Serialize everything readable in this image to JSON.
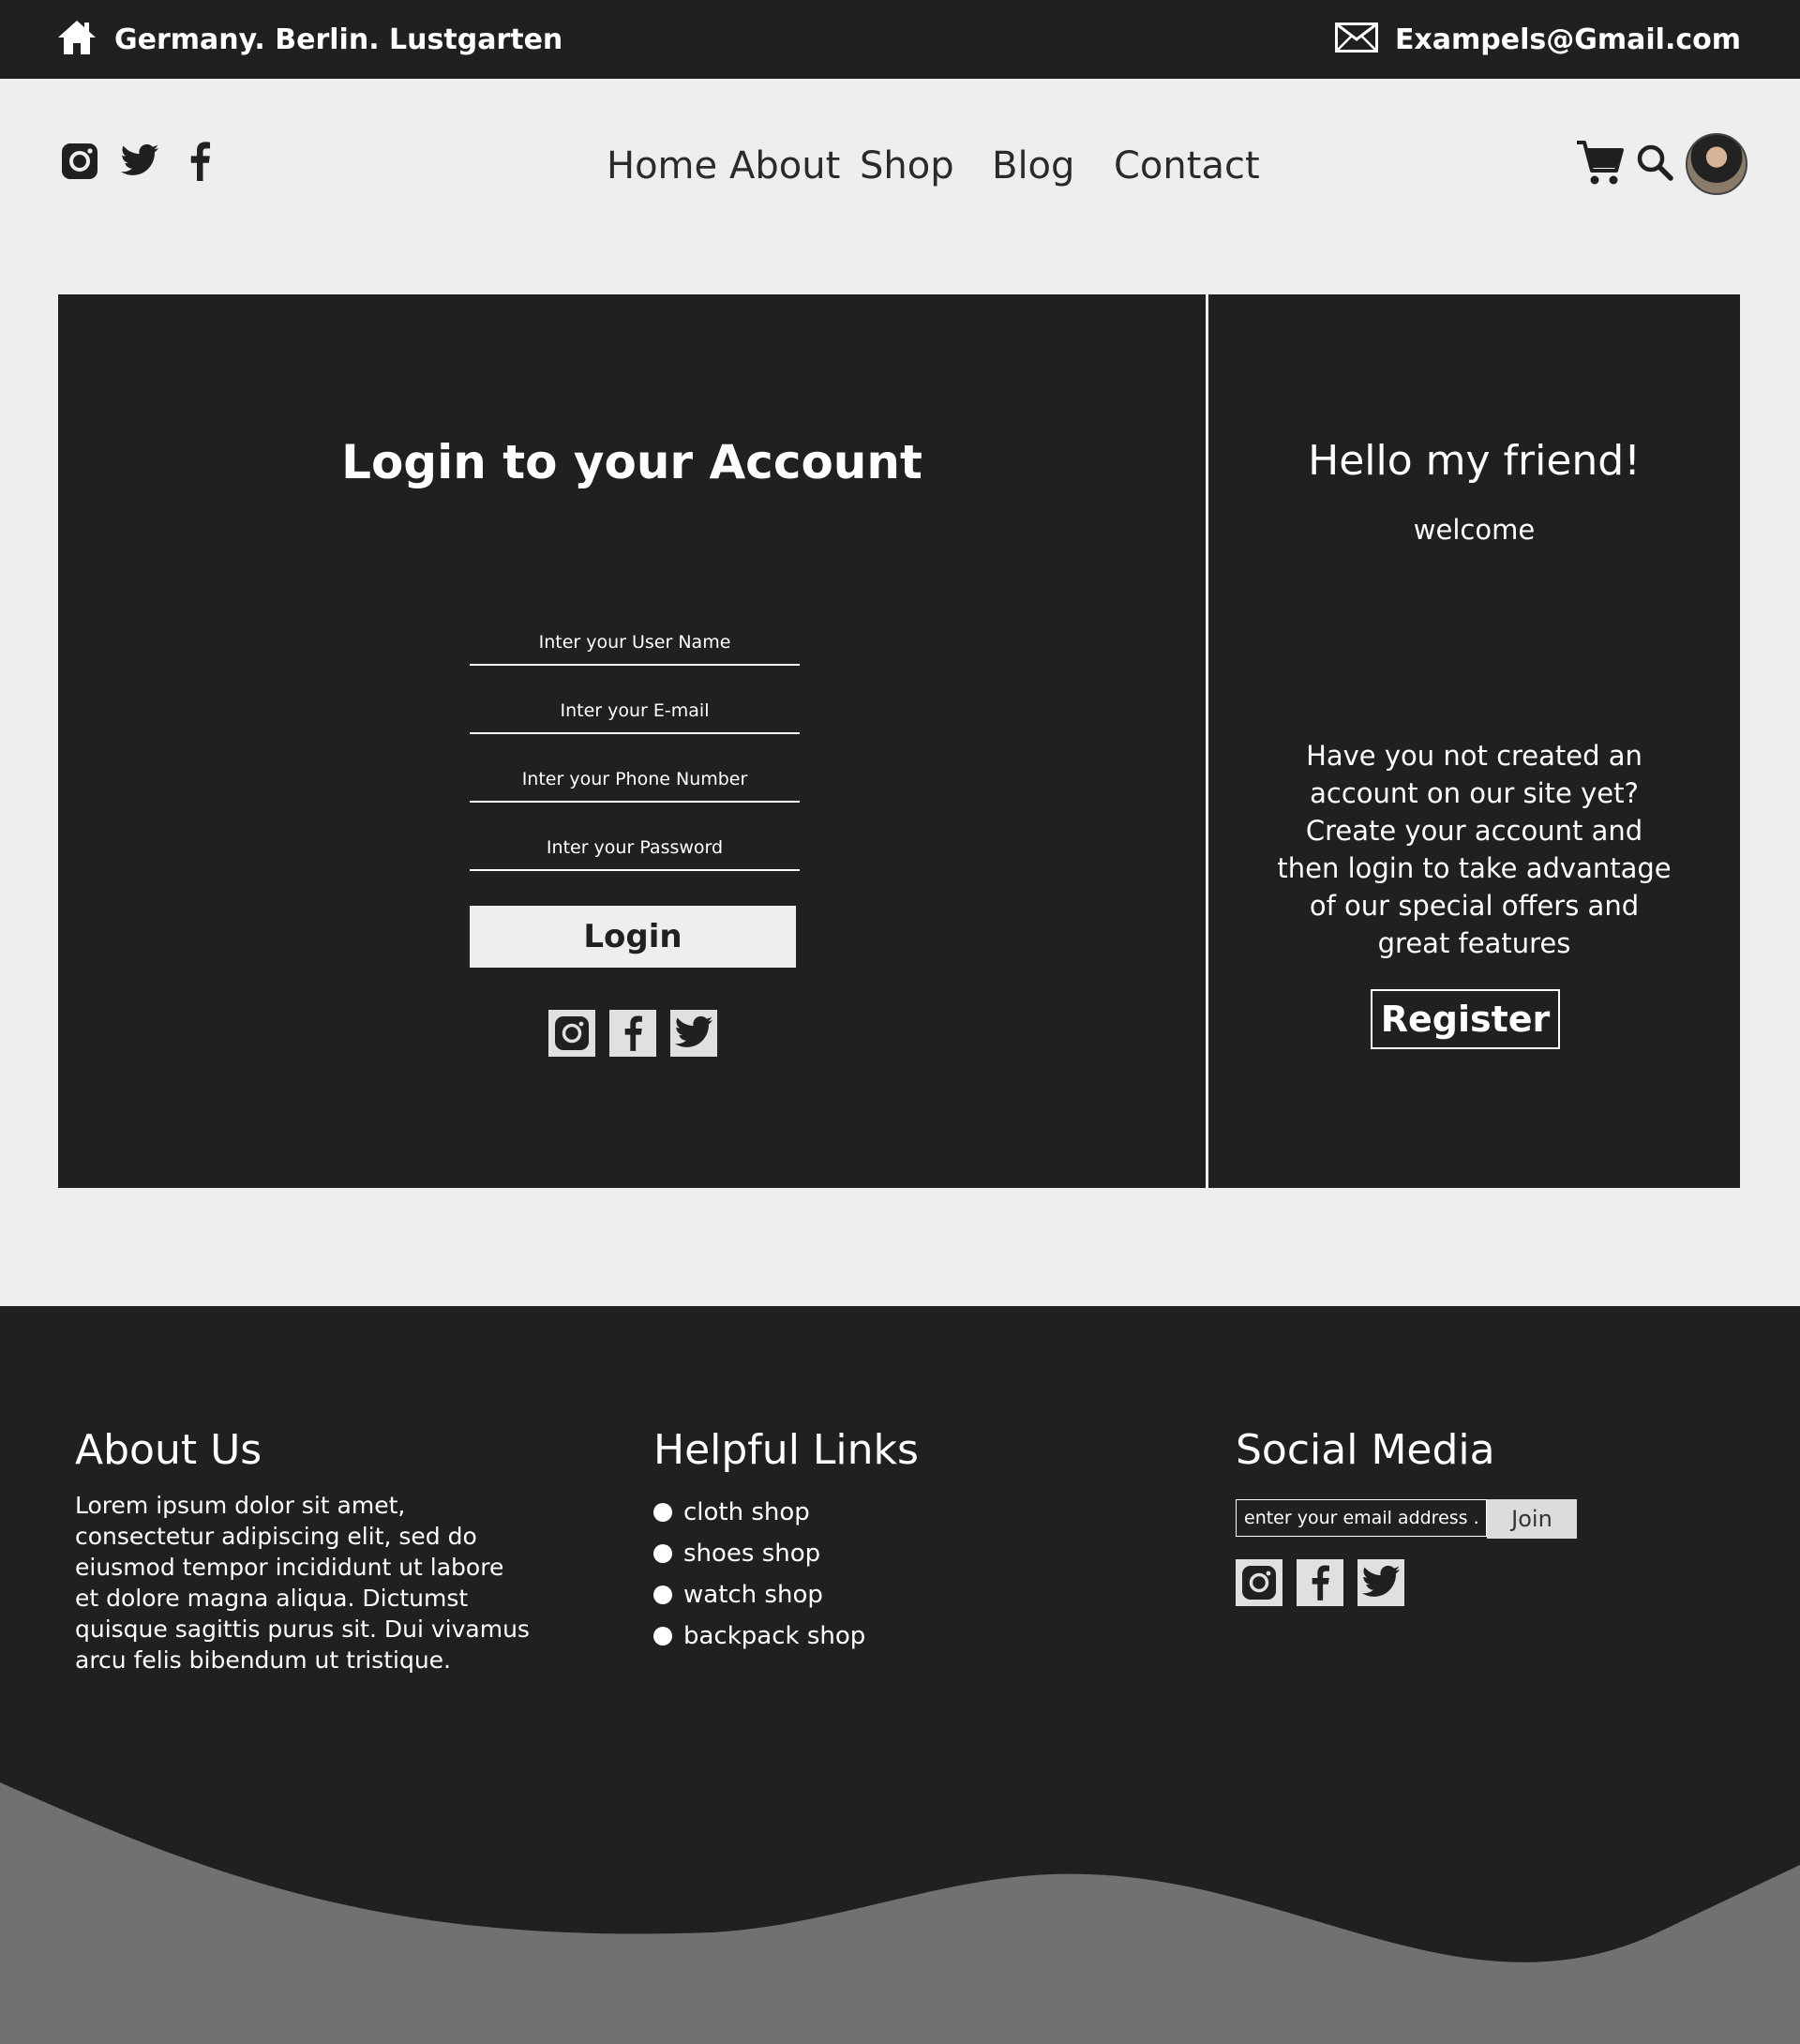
{
  "topbar": {
    "address": "Germany. Berlin. Lustgarten",
    "email": "Exampels@Gmail.com"
  },
  "nav": {
    "items": [
      "Home",
      "About",
      "Shop",
      "Blog",
      "Contact"
    ]
  },
  "header_icons": {
    "social": [
      "instagram-icon",
      "twitter-icon",
      "facebook-icon"
    ],
    "right": [
      "cart-icon",
      "search-icon",
      "avatar"
    ]
  },
  "login": {
    "title": "Login to your Account",
    "username_placeholder": "Inter your User Name",
    "email_placeholder": "Inter your E-mail",
    "phone_placeholder": "Inter your Phone Number",
    "password_placeholder": "Inter your Password",
    "button": "Login"
  },
  "welcome_panel": {
    "hello": "Hello my friend!",
    "welcome": "welcome",
    "promo": "Have you not created an account on our site yet? Create your account and then login to take advantage of our special offers and great features",
    "register": "Register"
  },
  "footer": {
    "about_title": "About Us",
    "about_text": "Lorem ipsum dolor sit amet, consectetur adipiscing elit, sed do eiusmod tempor incididunt ut labore et dolore magna aliqua. Dictumst quisque sagittis purus sit. Dui vivamus arcu felis bibendum ut tristique.",
    "links_title": "Helpful Links",
    "links": [
      "cloth shop",
      "shoes shop",
      "watch shop",
      "backpack shop"
    ],
    "social_title": "Social Media",
    "newsletter_placeholder": "enter your email address ...",
    "join": "Join"
  },
  "colors": {
    "dark": "#202020",
    "light": "#eeeeee",
    "wave": "#717171"
  }
}
